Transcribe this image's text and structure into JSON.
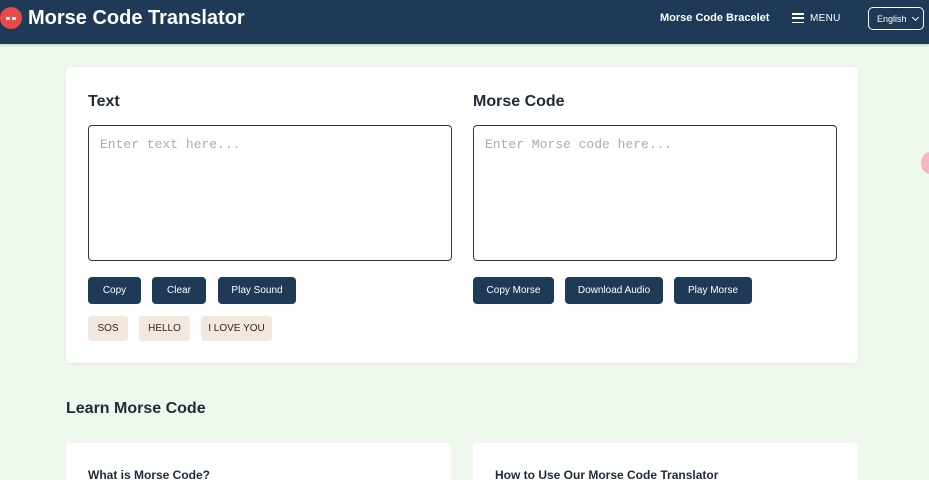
{
  "header": {
    "title": "Morse Code Translator",
    "nav_link": "Morse Code Bracelet",
    "menu_label": "MENU",
    "language": "English"
  },
  "text_panel": {
    "title": "Text",
    "placeholder": "Enter text here...",
    "buttons": [
      "Copy",
      "Clear",
      "Play Sound"
    ],
    "examples": [
      "SOS",
      "HELLO",
      "I LOVE YOU"
    ]
  },
  "morse_panel": {
    "title": "Morse Code",
    "placeholder": "Enter Morse code here...",
    "buttons": [
      "Copy Morse",
      "Download Audio",
      "Play Morse"
    ]
  },
  "learn": {
    "heading": "Learn Morse Code",
    "cards": [
      "What is Morse Code?",
      "How to Use Our Morse Code Translator"
    ]
  },
  "colors": {
    "header_bg": "#1e3a56",
    "page_bg": "#eff8ec",
    "button_bg": "#1e3a56",
    "chip_bg": "#f3e7de",
    "logo_red": "#e84a4a"
  }
}
